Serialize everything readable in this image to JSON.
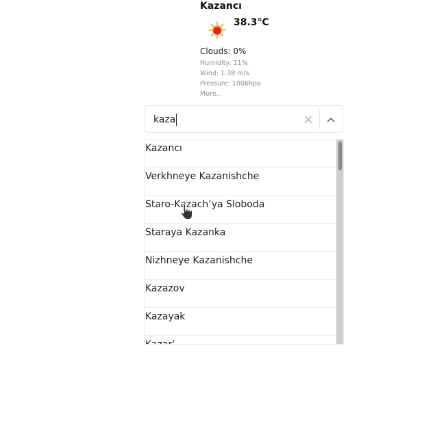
{
  "weather": {
    "city": "Kazancı",
    "icon": "sun-icon",
    "temperature": "38.3°C",
    "clouds": "Clouds: 0%",
    "humidity": "Humidity: 11%",
    "wind": "Wind: 1.38 m/s",
    "pressure": "Pressure: 1006hpa",
    "more": "More.."
  },
  "search": {
    "value": "kaza",
    "clear_icon": "close-icon",
    "toggle_icon": "chevron-up-icon"
  },
  "dropdown": {
    "options": [
      "Kazancı",
      "Verkhneye Kazanishche",
      "Staro-Kazach’ya Sloboda",
      "Staraya Kazanka",
      "Nizhneye Kazanishche",
      "Kazazov",
      "Kazayak",
      "Kazar’"
    ]
  },
  "colors": {
    "sun_rays": "#f5a623",
    "sun_core": "#e8221a",
    "border": "#e4e4e4",
    "scrollbar_track": "#cfcfcf",
    "scrollbar_thumb": "#8a8a8a"
  }
}
